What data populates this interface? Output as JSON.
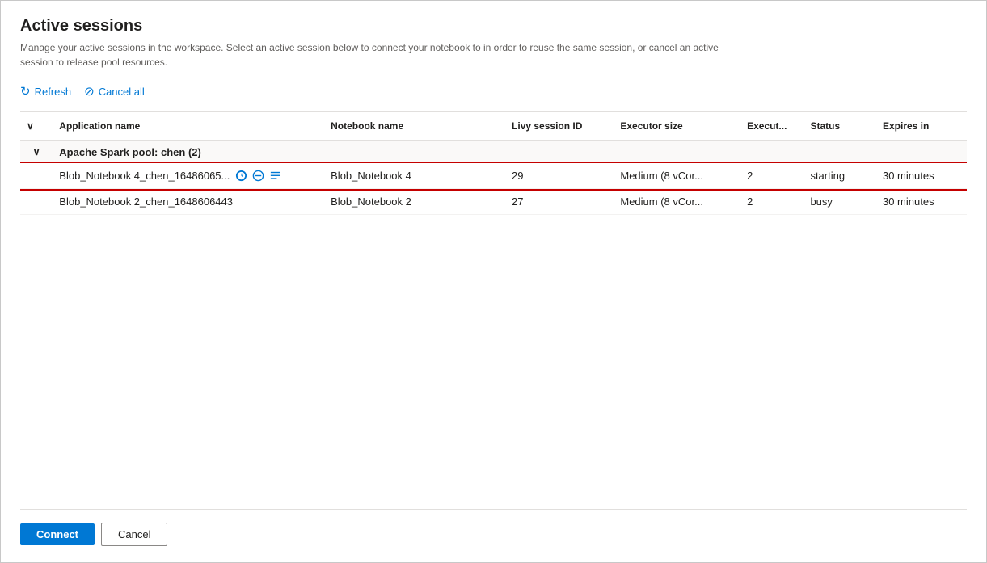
{
  "dialog": {
    "title": "Active sessions",
    "description": "Manage your active sessions in the workspace. Select an active session below to connect your notebook to in order to reuse the same session, or cancel an active session to release pool resources.",
    "toolbar": {
      "refresh_label": "Refresh",
      "cancel_all_label": "Cancel all"
    },
    "table": {
      "columns": [
        {
          "key": "expand",
          "label": ""
        },
        {
          "key": "app_name",
          "label": "Application name"
        },
        {
          "key": "notebook_name",
          "label": "Notebook name"
        },
        {
          "key": "livy_session_id",
          "label": "Livy session ID"
        },
        {
          "key": "executor_size",
          "label": "Executor size"
        },
        {
          "key": "executor_count",
          "label": "Execut..."
        },
        {
          "key": "status",
          "label": "Status"
        },
        {
          "key": "expires_in",
          "label": "Expires in"
        }
      ],
      "groups": [
        {
          "group_name": "Apache Spark pool: chen (2)",
          "rows": [
            {
              "id": "row1",
              "selected": true,
              "app_name": "Blob_Notebook 4_chen_16486065...",
              "notebook_name": "Blob_Notebook 4",
              "livy_session_id": "29",
              "executor_size": "Medium (8 vCor...",
              "executor_count": "2",
              "status": "starting",
              "expires_in": "30 minutes",
              "has_icons": true
            },
            {
              "id": "row2",
              "selected": false,
              "app_name": "Blob_Notebook 2_chen_1648606443",
              "notebook_name": "Blob_Notebook 2",
              "livy_session_id": "27",
              "executor_size": "Medium (8 vCor...",
              "executor_count": "2",
              "status": "busy",
              "expires_in": "30 minutes",
              "has_icons": false
            }
          ]
        }
      ]
    },
    "footer": {
      "connect_label": "Connect",
      "cancel_label": "Cancel"
    }
  }
}
